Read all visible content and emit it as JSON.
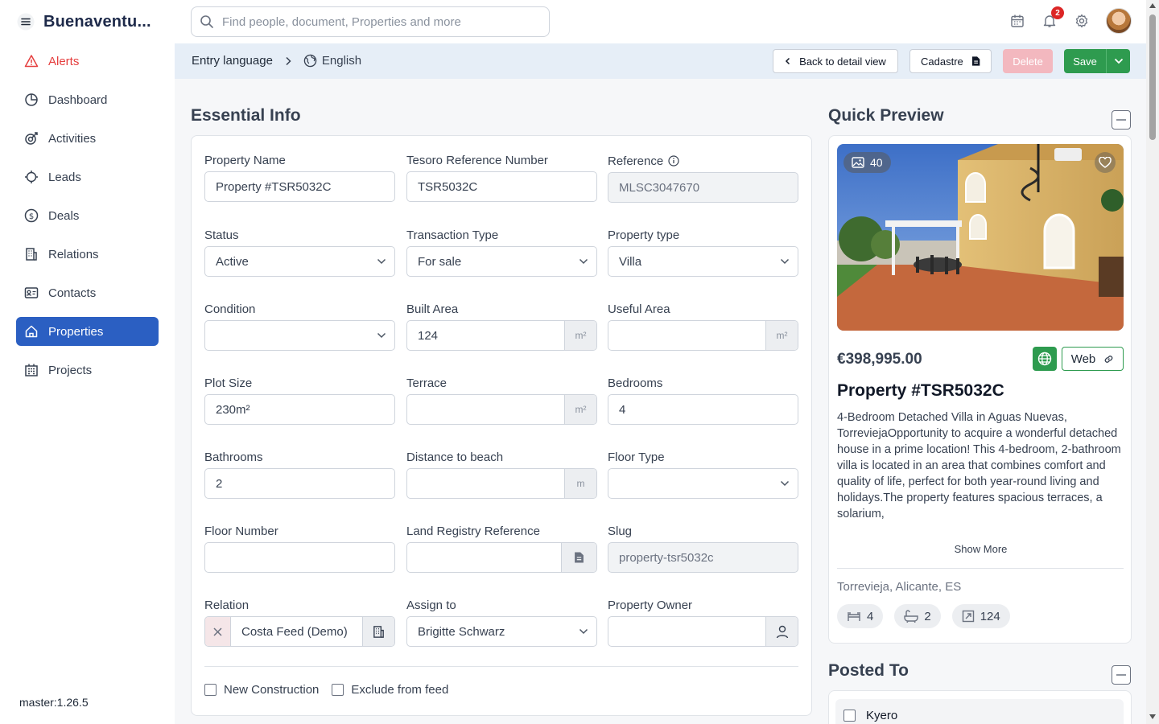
{
  "app": {
    "brand": "Buenaventu..."
  },
  "sidebar": {
    "items": [
      {
        "label": "Alerts",
        "icon": "alert-triangle-icon"
      },
      {
        "label": "Dashboard",
        "icon": "pie-chart-icon"
      },
      {
        "label": "Activities",
        "icon": "activity-icon"
      },
      {
        "label": "Leads",
        "icon": "target-icon"
      },
      {
        "label": "Deals",
        "icon": "dollar-circle-icon"
      },
      {
        "label": "Relations",
        "icon": "building-icon"
      },
      {
        "label": "Contacts",
        "icon": "contact-card-icon"
      },
      {
        "label": "Properties",
        "icon": "home-icon"
      },
      {
        "label": "Projects",
        "icon": "apartments-icon"
      }
    ],
    "active": "Properties",
    "version": "master:1.26.5"
  },
  "search": {
    "placeholder": "Find people, document, Properties and more"
  },
  "notifications": {
    "count": "2"
  },
  "subbar": {
    "entry_language_label": "Entry language",
    "language": "English",
    "back_label": "Back to detail view",
    "cadastre_label": "Cadastre",
    "delete_label": "Delete",
    "save_label": "Save"
  },
  "essential": {
    "title": "Essential Info",
    "fields": {
      "property_name": {
        "label": "Property Name",
        "value": "Property #TSR5032C"
      },
      "tesoro_ref": {
        "label": "Tesoro Reference Number",
        "value": "TSR5032C"
      },
      "reference": {
        "label": "Reference",
        "value": "MLSC3047670"
      },
      "status": {
        "label": "Status",
        "value": "Active"
      },
      "transaction_type": {
        "label": "Transaction Type",
        "value": "For sale"
      },
      "property_type": {
        "label": "Property type",
        "value": "Villa"
      },
      "condition": {
        "label": "Condition",
        "value": ""
      },
      "built_area": {
        "label": "Built Area",
        "value": "124",
        "unit": "m²"
      },
      "useful_area": {
        "label": "Useful Area",
        "value": "",
        "unit": "m²"
      },
      "plot_size": {
        "label": "Plot Size",
        "value": "230m²"
      },
      "terrace": {
        "label": "Terrace",
        "value": "",
        "unit": "m²"
      },
      "bedrooms": {
        "label": "Bedrooms",
        "value": "4"
      },
      "bathrooms": {
        "label": "Bathrooms",
        "value": "2"
      },
      "distance_beach": {
        "label": "Distance to beach",
        "value": "",
        "unit": "m"
      },
      "floor_type": {
        "label": "Floor Type",
        "value": ""
      },
      "floor_number": {
        "label": "Floor Number",
        "value": ""
      },
      "land_registry": {
        "label": "Land Registry Reference",
        "value": ""
      },
      "slug": {
        "label": "Slug",
        "value": "property-tsr5032c"
      },
      "relation": {
        "label": "Relation",
        "value": "Costa Feed (Demo)"
      },
      "assign_to": {
        "label": "Assign to",
        "value": "Brigitte Schwarz"
      },
      "property_owner": {
        "label": "Property Owner",
        "value": ""
      }
    },
    "checkboxes": {
      "new_construction": "New Construction",
      "exclude_feed": "Exclude from feed"
    }
  },
  "preview": {
    "title": "Quick Preview",
    "photo_count": "40",
    "price": "€398,995.00",
    "web_label": "Web",
    "property_title": "Property #TSR5032C",
    "description": "4-Bedroom Detached Villa in Aguas Nuevas, TorreviejaOpportunity to acquire a wonderful detached house in a prime location! This 4-bedroom, 2-bathroom villa is located in an area that combines comfort and quality of life, perfect for both year-round living and holidays.The property features spacious terraces, a solarium,",
    "show_more": "Show More",
    "location": "Torrevieja, Alicante, ES",
    "bedrooms": "4",
    "bathrooms": "2",
    "area": "124"
  },
  "posted": {
    "title": "Posted To",
    "items": [
      "Kyero"
    ]
  },
  "colors": {
    "primary": "#2b5fc2",
    "success": "#2e9b4f",
    "danger": "#e53e3e",
    "subbar": "#e6eef7"
  }
}
